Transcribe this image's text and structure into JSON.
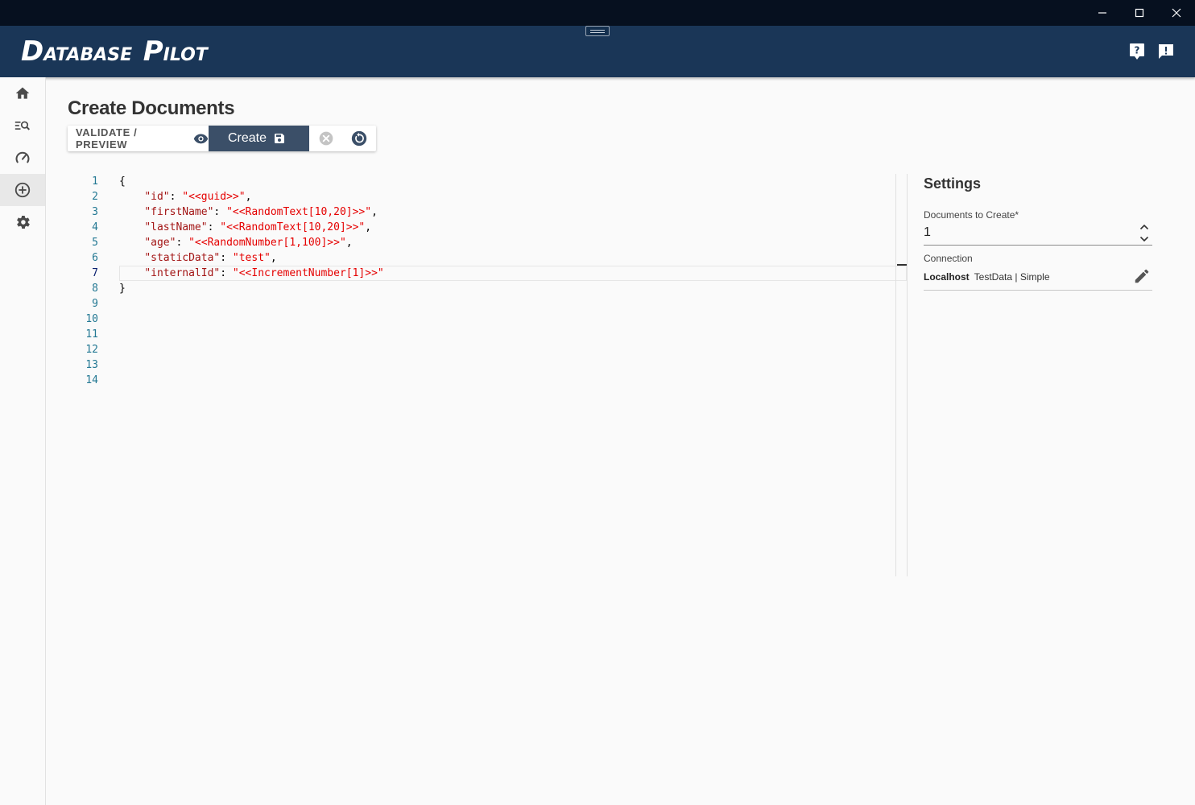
{
  "app": {
    "logo_first_big": "D",
    "logo_first_rest": "ATABASE",
    "logo_second_big": "P",
    "logo_second_rest": "ILOT"
  },
  "window_controls": {
    "minimize_icon": "minimize-icon",
    "maximize_icon": "maximize-icon",
    "close_icon": "close-icon"
  },
  "header_actions": [
    "help-icon",
    "feedback-icon"
  ],
  "sidebar": {
    "items": [
      {
        "icon": "home-icon",
        "active": false
      },
      {
        "icon": "query-search-icon",
        "active": false
      },
      {
        "icon": "dashboard-gauge-icon",
        "active": false
      },
      {
        "icon": "add-circle-icon",
        "active": true
      },
      {
        "icon": "gear-icon",
        "active": false
      }
    ]
  },
  "page": {
    "title": "Create Documents"
  },
  "toolbar": {
    "validate_label": "VALIDATE / PREVIEW",
    "create_label": "Create"
  },
  "editor": {
    "line_numbers": [
      "1",
      "2",
      "3",
      "4",
      "5",
      "6",
      "7",
      "8",
      "9",
      "10",
      "11",
      "12",
      "13",
      "14"
    ],
    "current_line": 7,
    "lines": [
      {
        "indent": "",
        "key": "",
        "sep": "",
        "value": "",
        "tail": "{"
      },
      {
        "indent": "    ",
        "key": "\"id\"",
        "sep": ": ",
        "value": "\"<<guid>>\"",
        "tail": ","
      },
      {
        "indent": "    ",
        "key": "\"firstName\"",
        "sep": ": ",
        "value": "\"<<RandomText[10,20]>>\"",
        "tail": ","
      },
      {
        "indent": "    ",
        "key": "\"lastName\"",
        "sep": ": ",
        "value": "\"<<RandomText[10,20]>>\"",
        "tail": ","
      },
      {
        "indent": "    ",
        "key": "\"age\"",
        "sep": ": ",
        "value": "\"<<RandomNumber[1,100]>>\"",
        "tail": ","
      },
      {
        "indent": "    ",
        "key": "\"staticData\"",
        "sep": ": ",
        "value": "\"test\"",
        "tail": ","
      },
      {
        "indent": "    ",
        "key": "\"internalId\"",
        "sep": ": ",
        "value": "\"<<IncrementNumber[1]>>\"",
        "tail": ""
      },
      {
        "indent": "",
        "key": "",
        "sep": "",
        "value": "",
        "tail": "}"
      }
    ]
  },
  "settings": {
    "title": "Settings",
    "documents_label": "Documents to Create*",
    "documents_value": "1",
    "connection_label": "Connection",
    "connection_host": "Localhost",
    "connection_detail": "TestData | Simple"
  },
  "colors": {
    "titlebar": "#06101f",
    "appbar": "#1a3657",
    "create_button": "#3b4f68",
    "json_key": "#a31515",
    "json_string": "#e50000",
    "line_number": "#237893"
  }
}
